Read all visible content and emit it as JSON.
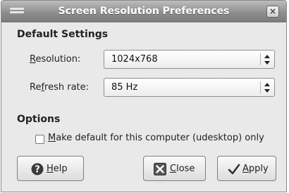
{
  "window": {
    "title": "Screen Resolution Preferences",
    "close_glyph": "×"
  },
  "default_settings": {
    "heading": "Default Settings",
    "resolution": {
      "mnemonic": "R",
      "label_rest": "esolution:",
      "value": "1024x768"
    },
    "refresh_rate": {
      "label_pre": "Re",
      "mnemonic": "f",
      "label_rest": "resh rate:",
      "value": "85 Hz"
    }
  },
  "options": {
    "heading": "Options",
    "make_default": {
      "mnemonic": "M",
      "label_rest": "ake default for this computer (udesktop) only",
      "checked": false
    }
  },
  "buttons": {
    "help": {
      "mnemonic": "H",
      "label_rest": "elp",
      "icon": "help-icon"
    },
    "close": {
      "mnemonic": "C",
      "label_rest": "lose",
      "icon": "close-x-icon"
    },
    "apply": {
      "mnemonic": "A",
      "label_rest": "pply",
      "icon": "checkmark-icon"
    }
  }
}
